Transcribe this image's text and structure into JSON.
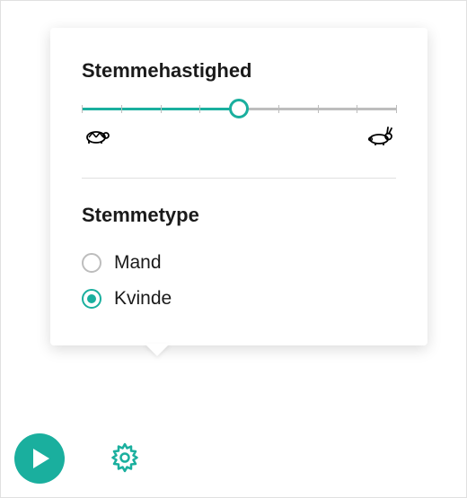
{
  "speed": {
    "title": "Stemmehastighed",
    "value": 4,
    "min": 0,
    "max": 8,
    "slow_icon": "turtle-icon",
    "fast_icon": "rabbit-icon"
  },
  "voice_type": {
    "title": "Stemmetype",
    "options": [
      {
        "label": "Mand",
        "selected": false
      },
      {
        "label": "Kvinde",
        "selected": true
      }
    ]
  },
  "colors": {
    "accent": "#1aaf9e",
    "track": "#bdbdbd"
  },
  "toolbar": {
    "play": "play-button",
    "settings": "gear-icon"
  }
}
